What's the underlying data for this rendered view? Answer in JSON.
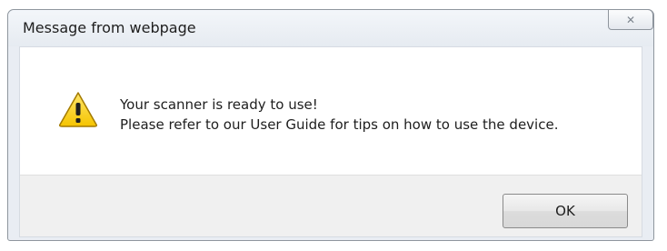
{
  "dialog": {
    "title": "Message from webpage",
    "close_glyph": "✕",
    "icon": "warning-icon",
    "message_lines": [
      "Your scanner is ready to use!",
      "Please refer to our User Guide for tips on how to use the device."
    ],
    "ok_label": "OK"
  },
  "colors": {
    "warning_yellow": "#f5c400",
    "warning_outline": "#a37a00",
    "content_background": "#ffffff",
    "footer_background": "#f0f0f0"
  }
}
